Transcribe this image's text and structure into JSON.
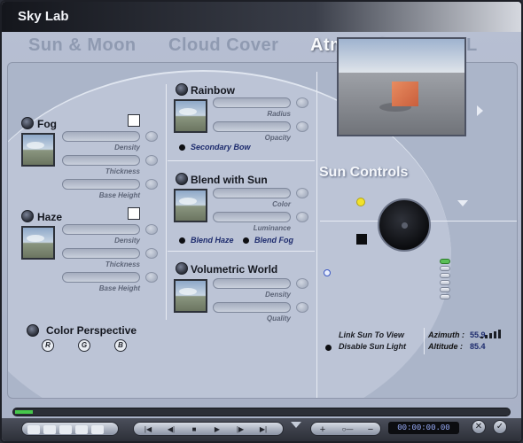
{
  "window": {
    "title": "Sky Lab"
  },
  "tabs": [
    {
      "label": "Sun & Moon"
    },
    {
      "label": "Cloud Cover"
    },
    {
      "label": "Atmosphere"
    },
    {
      "label": "IBL"
    }
  ],
  "fog": {
    "label": "Fog",
    "sliders": [
      "Density",
      "Thickness",
      "Base Height"
    ]
  },
  "haze": {
    "label": "Haze",
    "sliders": [
      "Density",
      "Thickness",
      "Base Height"
    ]
  },
  "color_perspective": {
    "label": "Color Perspective",
    "channels": [
      "R",
      "G",
      "B"
    ]
  },
  "rainbow": {
    "label": "Rainbow",
    "sliders": [
      "Radius",
      "Opacity"
    ],
    "option": "Secondary Bow"
  },
  "blend_with_sun": {
    "label": "Blend with Sun",
    "sliders": [
      "Color",
      "Luminance"
    ],
    "options": [
      "Blend Haze",
      "Blend Fog"
    ]
  },
  "volumetric_world": {
    "label": "Volumetric World",
    "sliders": [
      "Density",
      "Quality"
    ]
  },
  "sun_controls": {
    "title": "Sun Controls",
    "link_sun": "Link Sun To View",
    "disable_sun": "Disable Sun Light",
    "azimuth_label": "Azimuth :",
    "azimuth_value": "55.9",
    "altitude_label": "Altitude :",
    "altitude_value": "85.4"
  },
  "transport": {
    "timecode": "00:00:00.00"
  }
}
